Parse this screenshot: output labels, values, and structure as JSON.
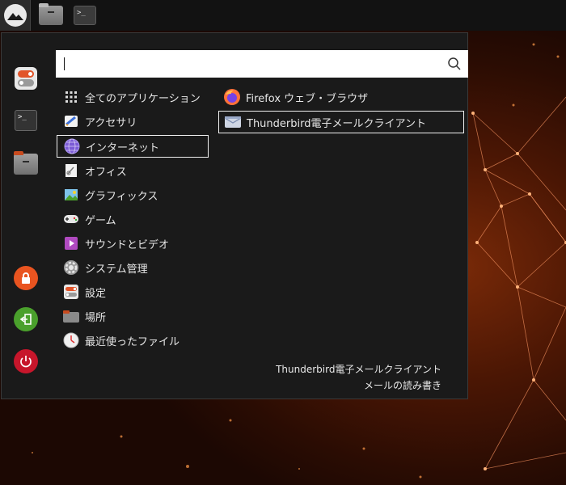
{
  "panel": {
    "items": [
      {
        "name": "whisker-menu",
        "icon": "ubuntu-studio-logo"
      },
      {
        "name": "file-manager",
        "icon": "folder-icon"
      },
      {
        "name": "terminal",
        "icon": "terminal-icon",
        "glyph": ">_"
      }
    ]
  },
  "sidebar": {
    "favorites": [
      {
        "name": "settings",
        "icon": "settings-toggle-icon"
      },
      {
        "name": "terminal",
        "icon": "terminal-icon",
        "glyph": ">_"
      },
      {
        "name": "file-manager",
        "icon": "folder-icon"
      }
    ],
    "actions": [
      {
        "name": "lock-screen",
        "icon": "lock-icon",
        "color": "#e95420"
      },
      {
        "name": "log-out",
        "icon": "logout-icon",
        "color": "#4aa02c"
      },
      {
        "name": "shutdown",
        "icon": "power-icon",
        "color": "#c7162b"
      }
    ]
  },
  "search": {
    "value": "",
    "placeholder": ""
  },
  "categories": [
    {
      "label": "全てのアプリケーション",
      "icon": "grid-icon"
    },
    {
      "label": "アクセサリ",
      "icon": "accessories-icon"
    },
    {
      "label": "インターネット",
      "icon": "internet-icon",
      "selected": true
    },
    {
      "label": "オフィス",
      "icon": "office-icon"
    },
    {
      "label": "グラフィックス",
      "icon": "graphics-icon"
    },
    {
      "label": "ゲーム",
      "icon": "gamepad-icon"
    },
    {
      "label": "サウンドとビデオ",
      "icon": "multimedia-icon"
    },
    {
      "label": "システム管理",
      "icon": "system-icon"
    },
    {
      "label": "設定",
      "icon": "settings-toggle-icon"
    },
    {
      "label": "場所",
      "icon": "folder-icon"
    },
    {
      "label": "最近使ったファイル",
      "icon": "clock-icon"
    }
  ],
  "apps": [
    {
      "label": "Firefox ウェブ・ブラウザ",
      "icon": "firefox-icon"
    },
    {
      "label": "Thunderbird電子メールクライアント",
      "icon": "thunderbird-icon",
      "selected": true
    }
  ],
  "description": {
    "title": "Thunderbird電子メールクライアント",
    "subtitle": "メールの読み書き"
  }
}
